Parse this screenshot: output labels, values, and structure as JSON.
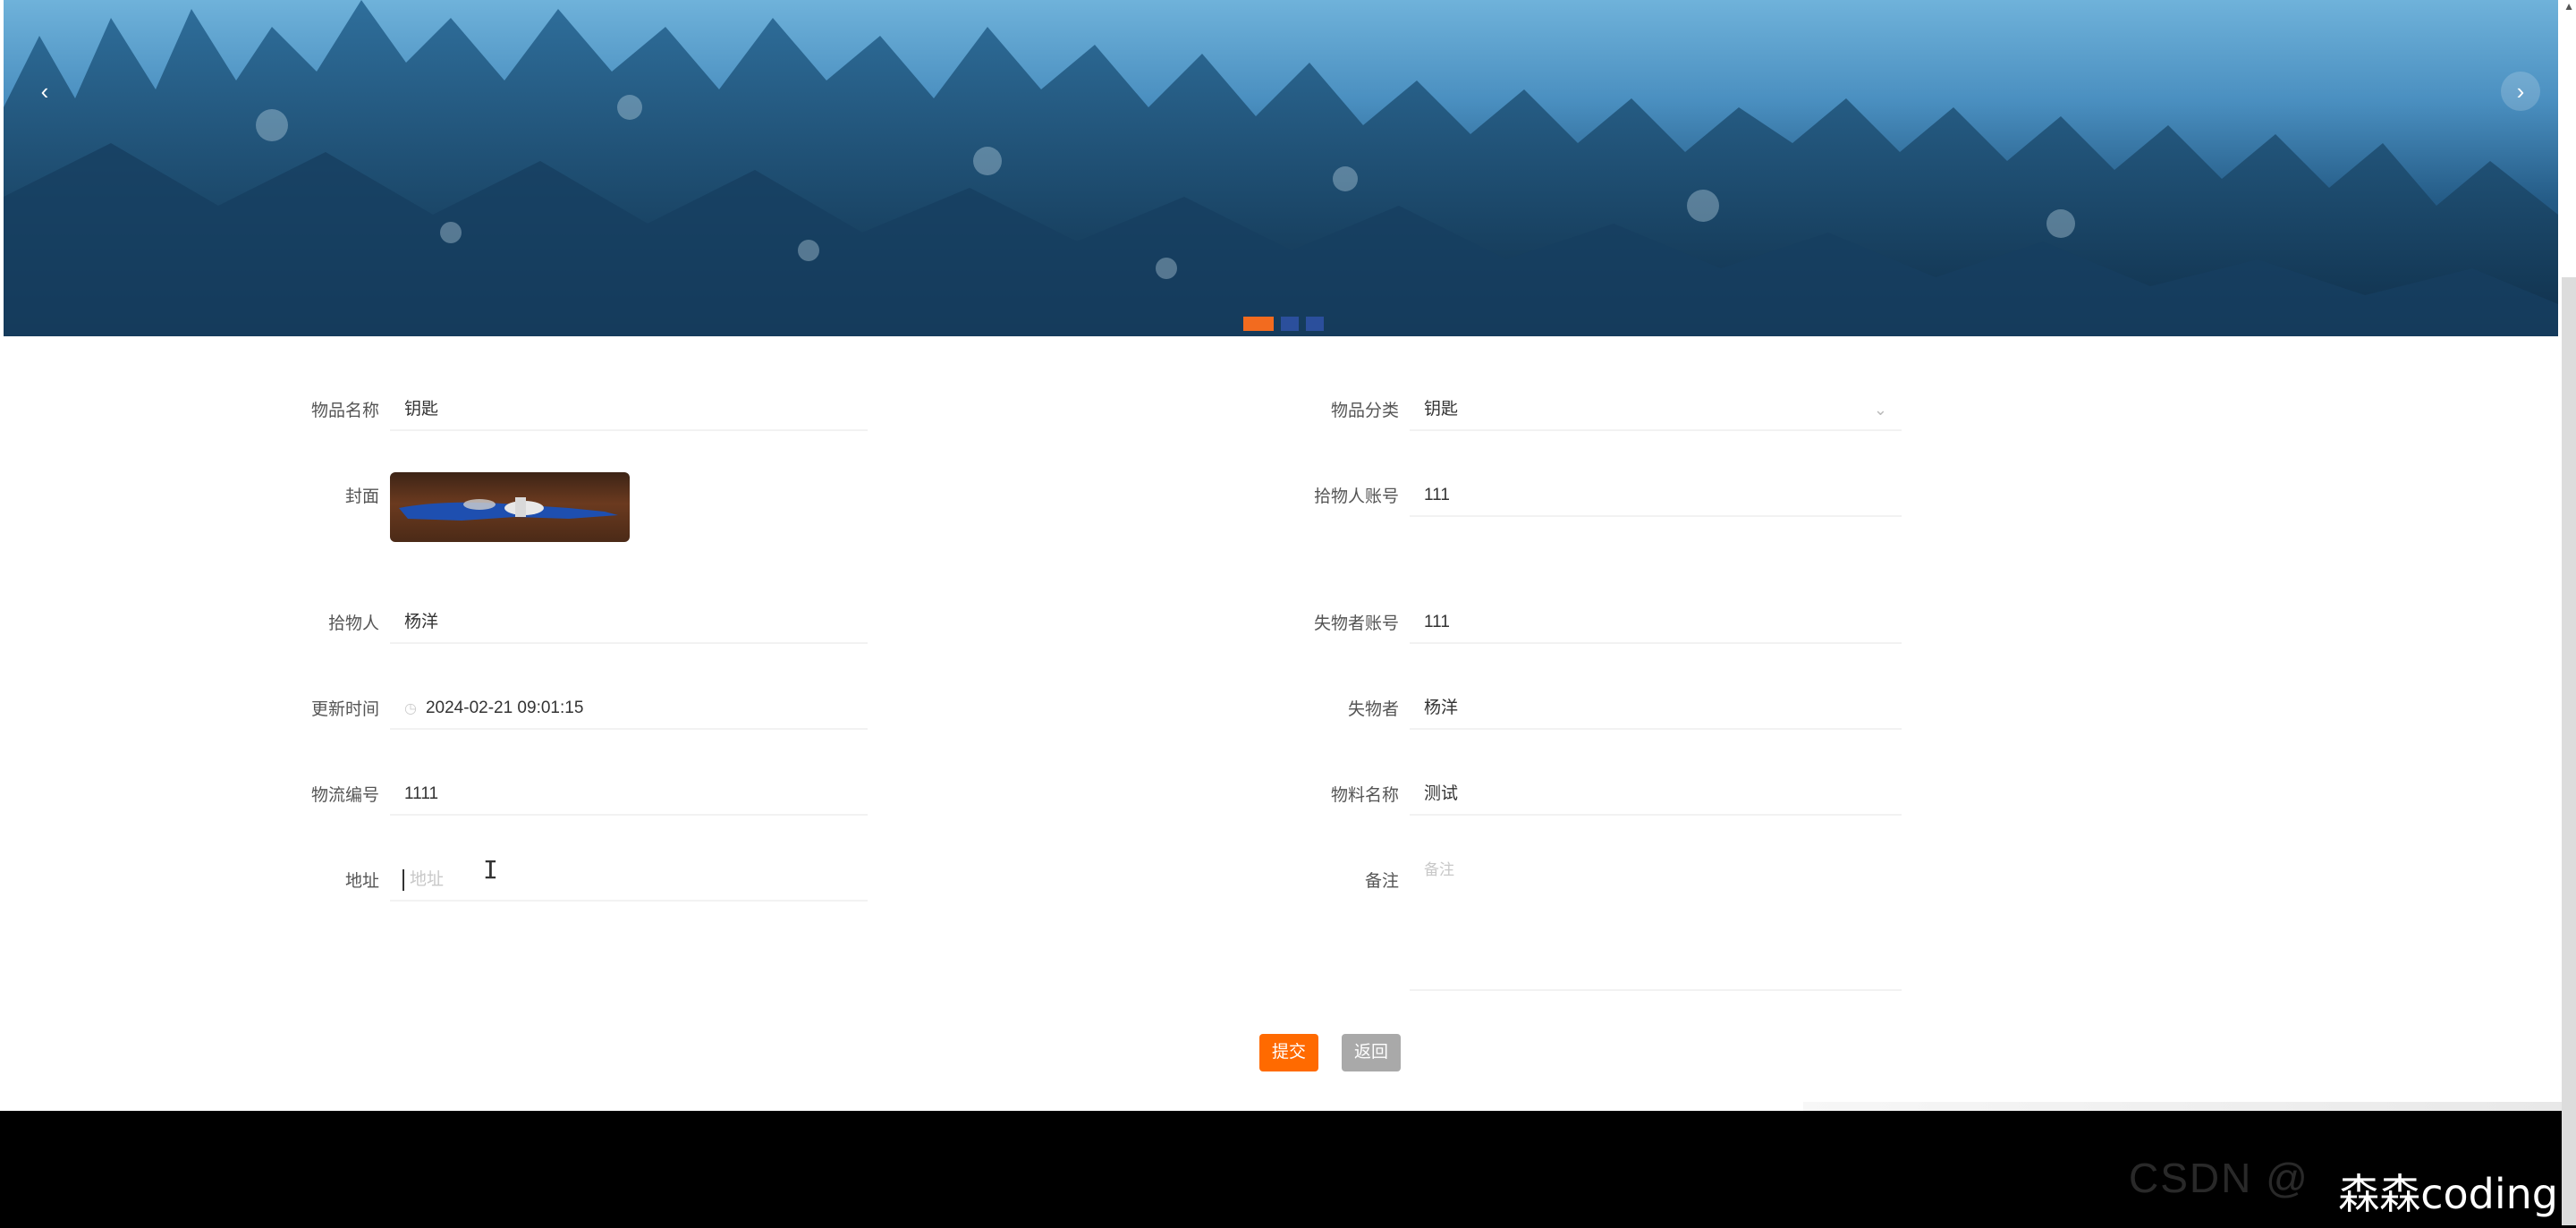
{
  "banner": {
    "prev_icon": "‹",
    "next_icon": "›",
    "dots": [
      {
        "active": true
      },
      {
        "active": false
      },
      {
        "active": false
      }
    ]
  },
  "form": {
    "item_name": {
      "label": "物品名称",
      "value": "钥匙"
    },
    "category": {
      "label": "物品分类",
      "value": "钥匙"
    },
    "cover": {
      "label": "封面"
    },
    "finder_account": {
      "label": "拾物人账号",
      "value": "111"
    },
    "finder": {
      "label": "拾物人",
      "value": "杨洋"
    },
    "loser_account": {
      "label": "失物者账号",
      "value": "111"
    },
    "update_time": {
      "label": "更新时间",
      "value": "2024-02-21 09:01:15"
    },
    "loser": {
      "label": "失物者",
      "value": "杨洋"
    },
    "logistics_no": {
      "label": "物流编号",
      "value": "1111"
    },
    "material_name": {
      "label": "物料名称",
      "value": "测试"
    },
    "address": {
      "label": "地址",
      "placeholder": "地址",
      "value": ""
    },
    "remark": {
      "label": "备注",
      "placeholder": "备注",
      "value": ""
    }
  },
  "actions": {
    "submit_label": "提交",
    "back_label": "返回"
  },
  "footer": {
    "watermark": "森森coding"
  },
  "colors": {
    "accent": "#ff6a00",
    "back_button": "#a9a9a9",
    "footer": "#000000"
  }
}
